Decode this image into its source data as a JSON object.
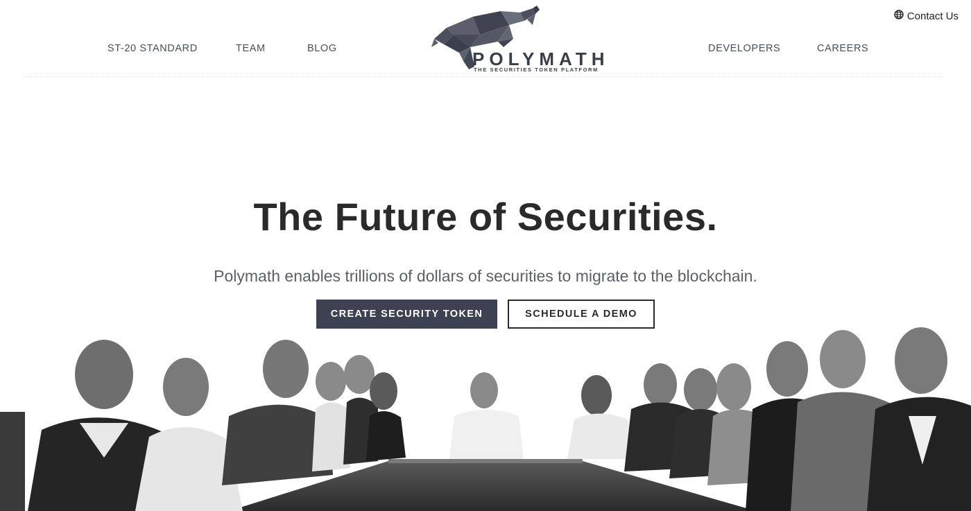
{
  "nav": {
    "left": [
      "ST-20 STANDARD",
      "TEAM",
      "BLOG"
    ],
    "right": [
      "DEVELOPERS",
      "CAREERS"
    ]
  },
  "contact": {
    "label": "Contact Us",
    "icon": "globe-icon"
  },
  "logo": {
    "wordmark": "POLYMATH",
    "tagline": "THE SECURITIES TOKEN PLATFORM",
    "icon": "bull-logo-icon"
  },
  "hero": {
    "title": "The Future of Securities.",
    "subtitle": "Polymath enables trillions of dollars of securities to migrate to the blockchain.",
    "primary_button": "CREATE SECURITY TOKEN",
    "secondary_button": "SCHEDULE A DEMO"
  },
  "colors": {
    "primary": "#3d4152",
    "text": "#2a2a2a",
    "muted": "#5c5f69"
  }
}
